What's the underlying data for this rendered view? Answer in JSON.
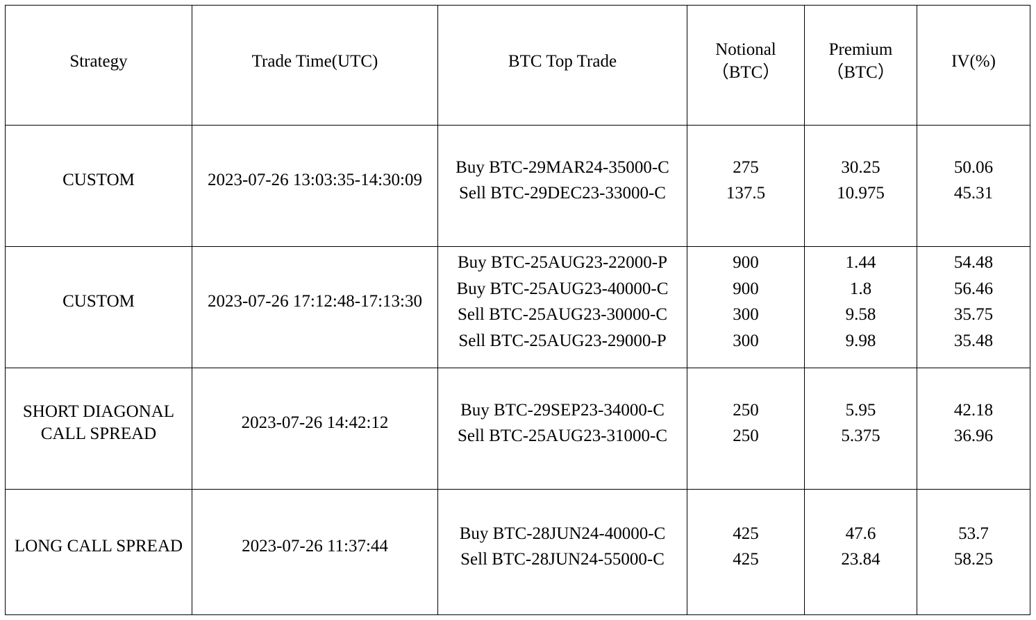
{
  "table": {
    "columns": [
      {
        "key": "strategy",
        "label": "Strategy"
      },
      {
        "key": "trade_time",
        "label": "Trade Time(UTC)"
      },
      {
        "key": "btc_top_trade",
        "label": "BTC Top Trade"
      },
      {
        "key": "notional",
        "label_line1": "Notional",
        "label_line2": "（BTC）"
      },
      {
        "key": "premium",
        "label_line1": "Premium",
        "label_line2": "（BTC）"
      },
      {
        "key": "iv",
        "label": "IV(%)"
      }
    ],
    "rows": [
      {
        "strategy": "CUSTOM",
        "trade_time": "2023-07-26 13:03:35-14:30:09",
        "legs": [
          {
            "trade": "Buy BTC-29MAR24-35000-C",
            "notional": "275",
            "premium": "30.25",
            "iv": "50.06"
          },
          {
            "trade": "Sell BTC-29DEC23-33000-C",
            "notional": "137.5",
            "premium": "10.975",
            "iv": "45.31"
          }
        ]
      },
      {
        "strategy": "CUSTOM",
        "trade_time": "2023-07-26 17:12:48-17:13:30",
        "legs": [
          {
            "trade": "Buy BTC-25AUG23-22000-P",
            "notional": "900",
            "premium": "1.44",
            "iv": "54.48"
          },
          {
            "trade": "Buy BTC-25AUG23-40000-C",
            "notional": "900",
            "premium": "1.8",
            "iv": "56.46"
          },
          {
            "trade": "Sell BTC-25AUG23-30000-C",
            "notional": "300",
            "premium": "9.58",
            "iv": "35.75"
          },
          {
            "trade": "Sell BTC-25AUG23-29000-P",
            "notional": "300",
            "premium": "9.98",
            "iv": "35.48"
          }
        ]
      },
      {
        "strategy_lines": [
          "SHORT DIAGONAL",
          "CALL SPREAD"
        ],
        "strategy": "SHORT DIAGONAL CALL SPREAD",
        "trade_time": "2023-07-26 14:42:12",
        "legs": [
          {
            "trade": "Buy BTC-29SEP23-34000-C",
            "notional": "250",
            "premium": "5.95",
            "iv": "42.18"
          },
          {
            "trade": "Sell BTC-25AUG23-31000-C",
            "notional": "250",
            "premium": "5.375",
            "iv": "36.96"
          }
        ]
      },
      {
        "strategy": "LONG CALL SPREAD",
        "trade_time": "2023-07-26 11:37:44",
        "legs": [
          {
            "trade": "Buy BTC-28JUN24-40000-C",
            "notional": "425",
            "premium": "47.6",
            "iv": "53.7"
          },
          {
            "trade": "Sell BTC-28JUN24-55000-C",
            "notional": "425",
            "premium": "23.84",
            "iv": "58.25"
          }
        ]
      }
    ]
  },
  "style": {
    "border_color": "#000000",
    "text_color": "#000000",
    "background": "#ffffff"
  }
}
